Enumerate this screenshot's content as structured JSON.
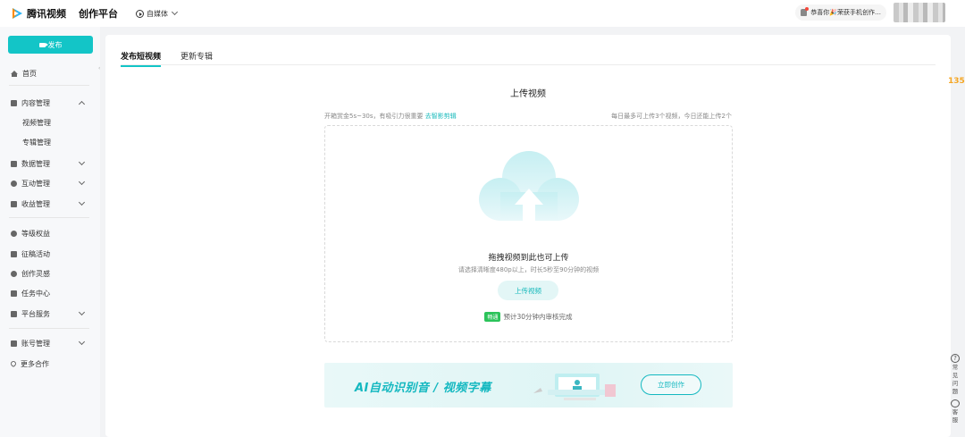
{
  "header": {
    "brand": "腾讯视频",
    "platform": "创作平台",
    "media_type": "自媒体",
    "notice": "恭喜你🎉荣获手机创作…"
  },
  "sidebar": {
    "publish_label": "发布",
    "items": [
      {
        "label": "首页"
      },
      {
        "label": "内容管理"
      },
      {
        "label": "视频管理"
      },
      {
        "label": "专辑管理"
      },
      {
        "label": "数据管理"
      },
      {
        "label": "互动管理"
      },
      {
        "label": "收益管理"
      },
      {
        "label": "等级权益"
      },
      {
        "label": "征稿活动"
      },
      {
        "label": "创作灵感"
      },
      {
        "label": "任务中心"
      },
      {
        "label": "平台服务"
      },
      {
        "label": "账号管理"
      },
      {
        "label": "更多合作"
      }
    ]
  },
  "main": {
    "tabs": [
      {
        "label": "发布短视频"
      },
      {
        "label": "更新专辑"
      }
    ],
    "upload_title": "上传视频",
    "tip_left": "开箱赏金5s~30s，有吸引力很重要",
    "tip_link": "去智影剪辑",
    "tip_right": "每日最多可上传3个视频，今日还能上传2个",
    "drop_title": "拖拽视频到此也可上传",
    "drop_sub": "请选择清晰度480p以上，时长5秒至90分钟的视频",
    "upload_button": "上传视频",
    "review_badge": "畅通",
    "review_text": "预计30分钟内审核完成",
    "banner_text": "AI自动识别音 / 视频字幕",
    "banner_button": "立即创作"
  },
  "right": {
    "float_logo": "135",
    "faq": "常见问题",
    "service": "客服"
  },
  "colors": {
    "accent": "#13c5c7",
    "badge_green": "#2bc35a"
  }
}
